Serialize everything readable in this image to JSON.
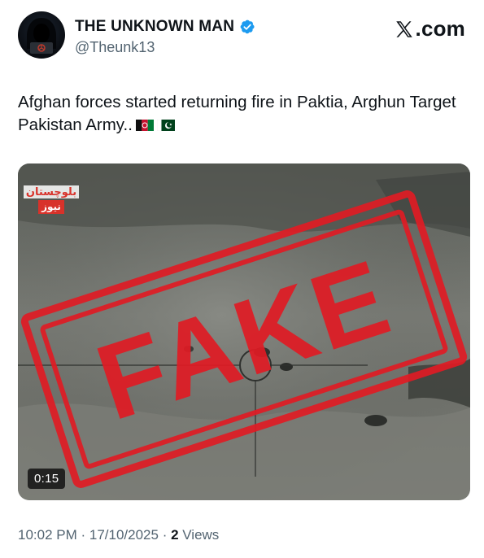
{
  "author": {
    "name": "THE UNKNOWN MAN",
    "handle": "@Theunk13",
    "verified": true,
    "avatar_icon": "hooded-hacker-icon"
  },
  "brand": {
    "label": ".com",
    "icon": "x-logo-icon"
  },
  "tweet": {
    "text": "Afghan forces started returning fire in Paktia, Arghun Target Pakistan Army..",
    "flags": [
      "afghanistan-flag-icon",
      "pakistan-flag-icon"
    ]
  },
  "media": {
    "channel_logo_top": "بلوچستان",
    "channel_logo_bottom": "نیوز",
    "duration": "0:15",
    "stamp_text": "FAKE",
    "stamp_color": "#e01b24"
  },
  "meta": {
    "time": "10:02 PM",
    "separator": " · ",
    "date": "17/10/2025",
    "views_count": "2",
    "views_label": " Views"
  }
}
